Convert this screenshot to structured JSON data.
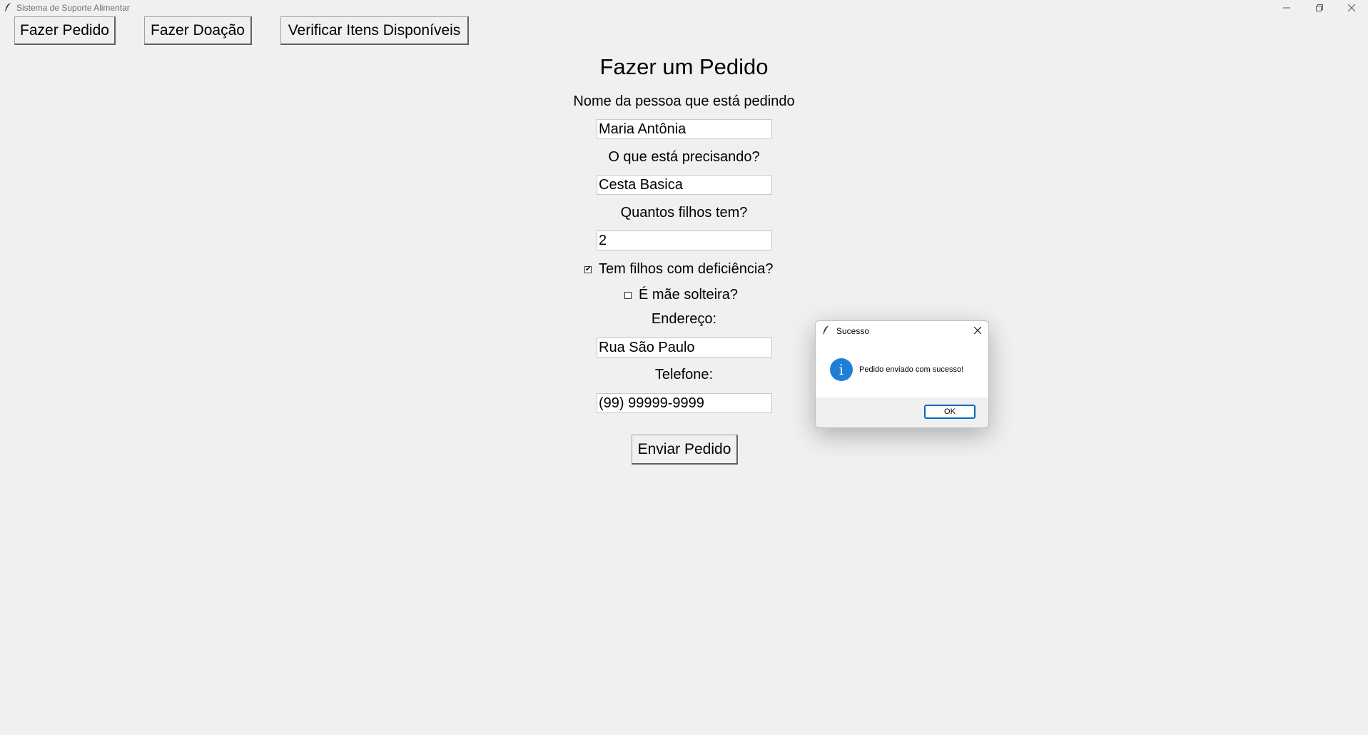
{
  "window": {
    "title": "Sistema de Suporte Alimentar"
  },
  "nav": {
    "order_button": "Fazer Pedido",
    "donation_button": "Fazer Doação",
    "check_items_button": "Verificar Itens Disponíveis"
  },
  "form": {
    "title": "Fazer um Pedido",
    "name_label": "Nome da pessoa que está pedindo",
    "name_value": "Maria Antônia",
    "need_label": "O que está precisando?",
    "need_value": "Cesta Basica",
    "children_label": "Quantos filhos tem?",
    "children_value": "2",
    "disability_label": "Tem filhos com deficiência?",
    "disability_checked": true,
    "single_mother_label": "É mãe solteira?",
    "single_mother_checked": false,
    "address_label": "Endereço:",
    "address_value": "Rua São Paulo",
    "phone_label": "Telefone:",
    "phone_value": "(99) 99999-9999",
    "submit_label": "Enviar Pedido"
  },
  "dialog": {
    "title": "Sucesso",
    "message": "Pedido enviado com sucesso!",
    "ok_label": "OK",
    "icon": "info-icon"
  },
  "colors": {
    "background": "#f0f0f0",
    "info_blue": "#1f7fd6",
    "accent_border": "#0067c0"
  }
}
